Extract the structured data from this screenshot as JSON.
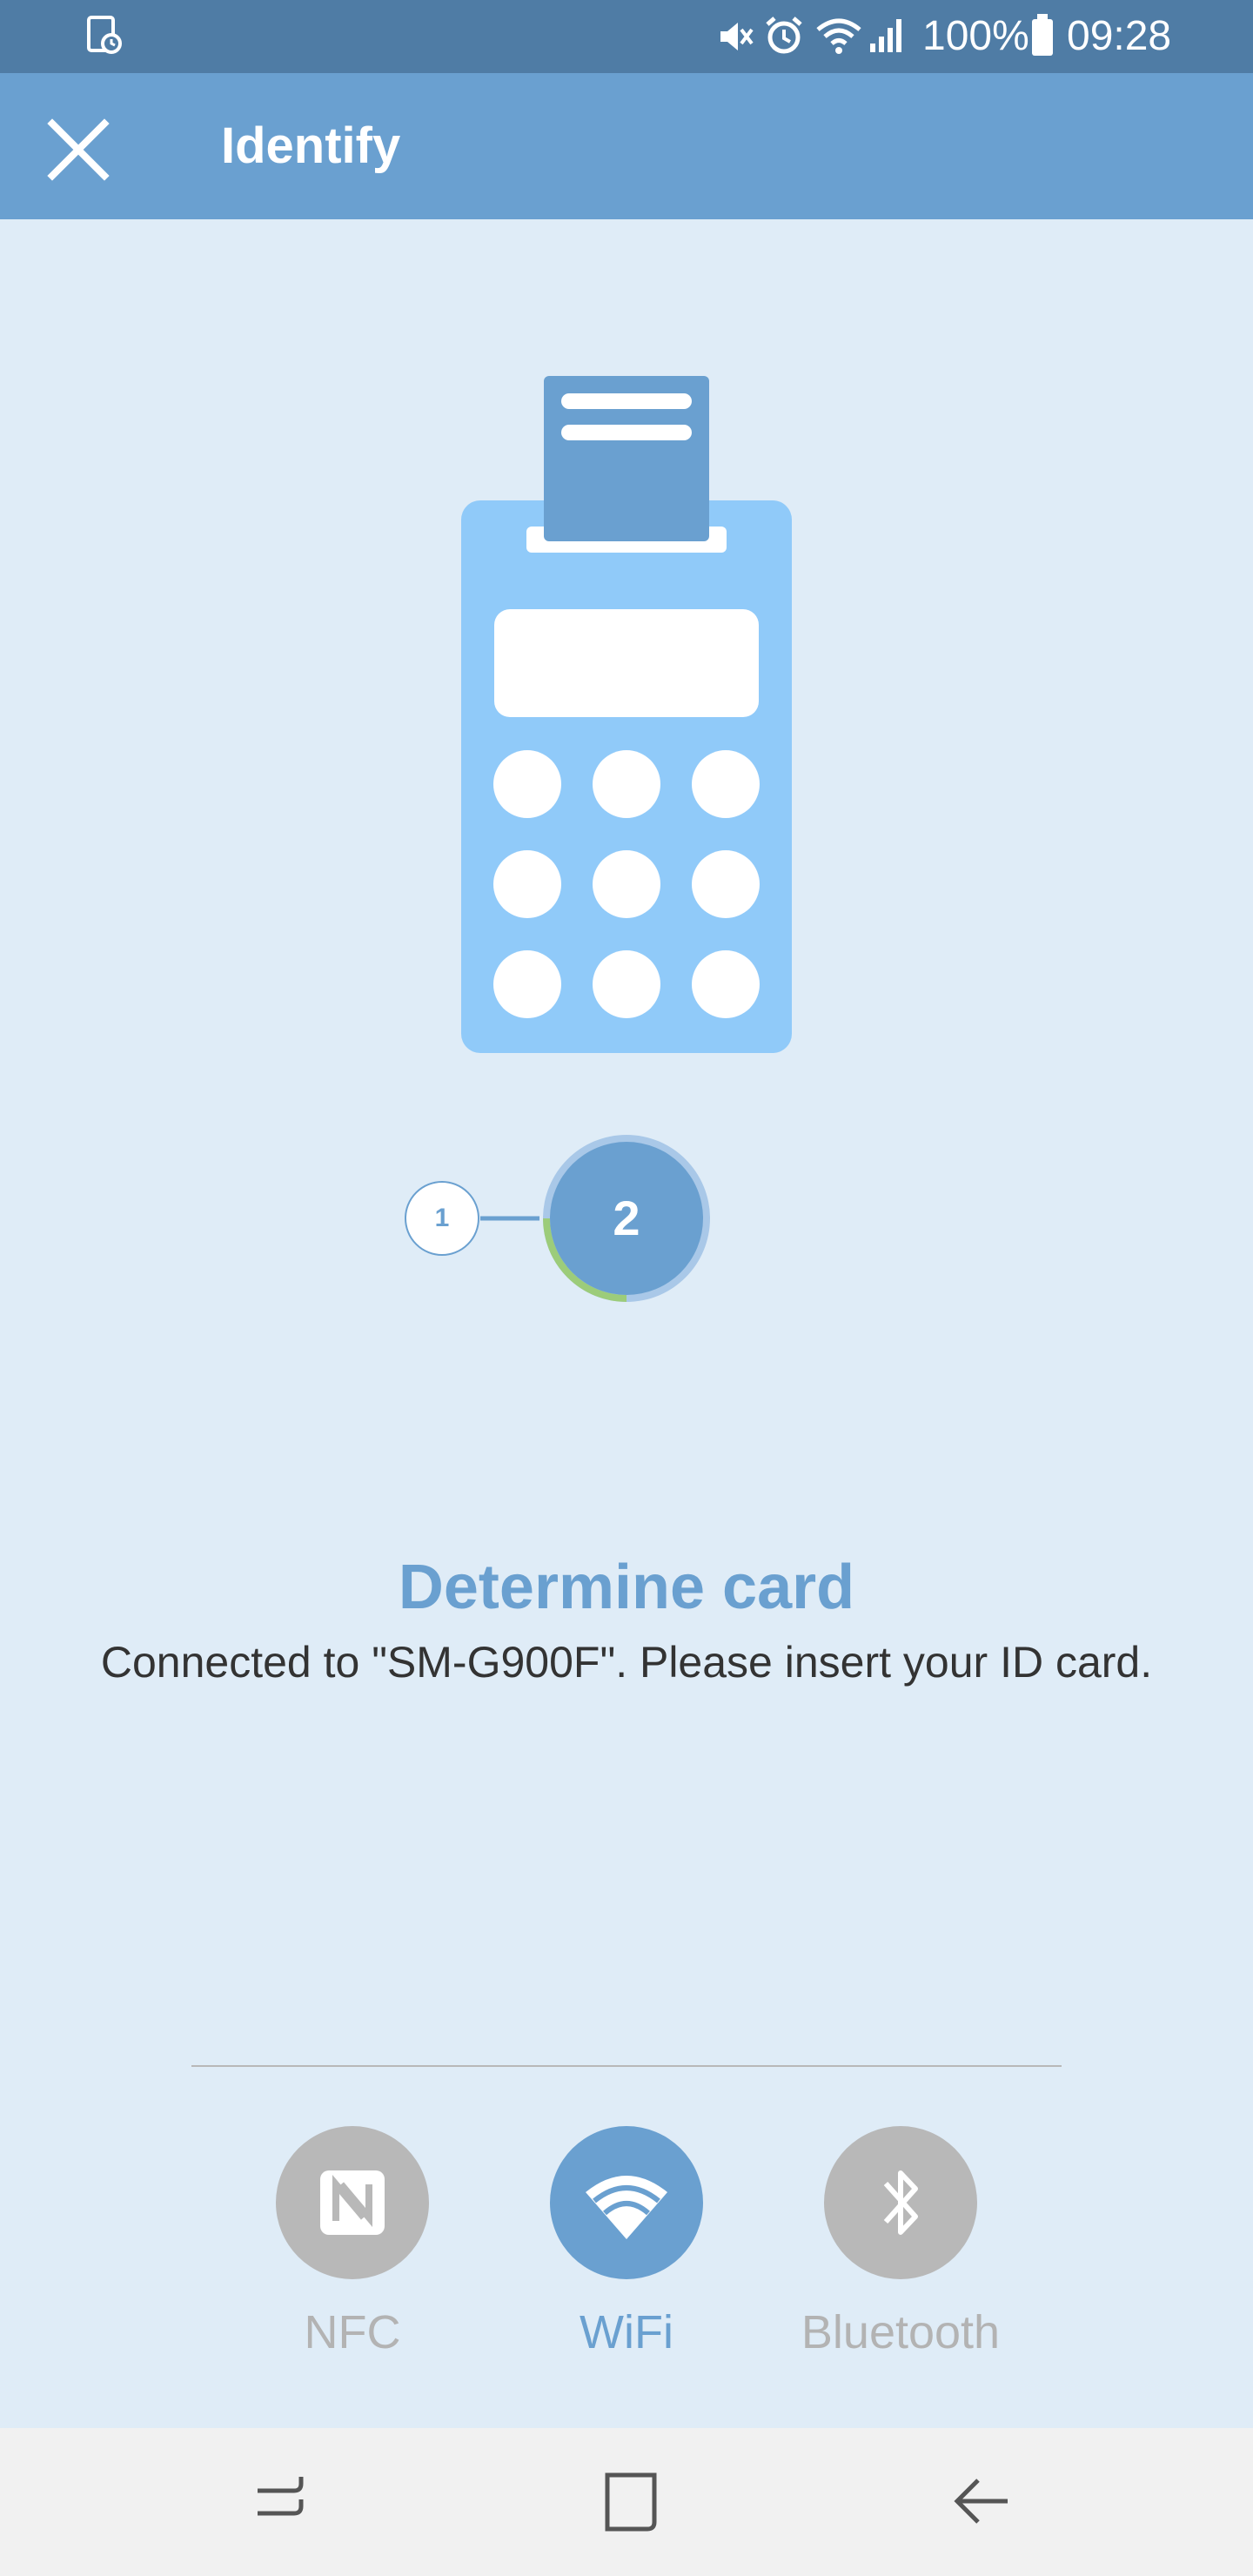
{
  "status_bar": {
    "battery": "100%",
    "time": "09:28",
    "icons": [
      "screen-time-icon",
      "mute-icon",
      "alarm-icon",
      "wifi-icon",
      "signal-icon",
      "battery-icon"
    ]
  },
  "app_bar": {
    "title": "Identify",
    "close_icon": "close-icon"
  },
  "illustration": {
    "icon": "card-reader-icon"
  },
  "steps": {
    "step1": "1",
    "step2": "2",
    "progress": 0.25
  },
  "message": {
    "headline": "Determine card",
    "body": "Connected to \"SM-G900F\". Please insert your ID card."
  },
  "connection_options": [
    {
      "label": "NFC",
      "icon": "nfc-icon",
      "selected": false
    },
    {
      "label": "WiFi",
      "icon": "wifi-icon",
      "selected": true
    },
    {
      "label": "Bluetooth",
      "icon": "bluetooth-icon",
      "selected": false
    }
  ],
  "nav_bar": {
    "icons": [
      "recents-icon",
      "home-icon",
      "back-icon"
    ]
  },
  "colors": {
    "accent": "#6aa0d0",
    "status_bar": "#4f7ca5",
    "background": "#dfecf7",
    "device": "#90caf9",
    "inactive": "#b8b8b8",
    "progress": "#9ccc7a"
  }
}
